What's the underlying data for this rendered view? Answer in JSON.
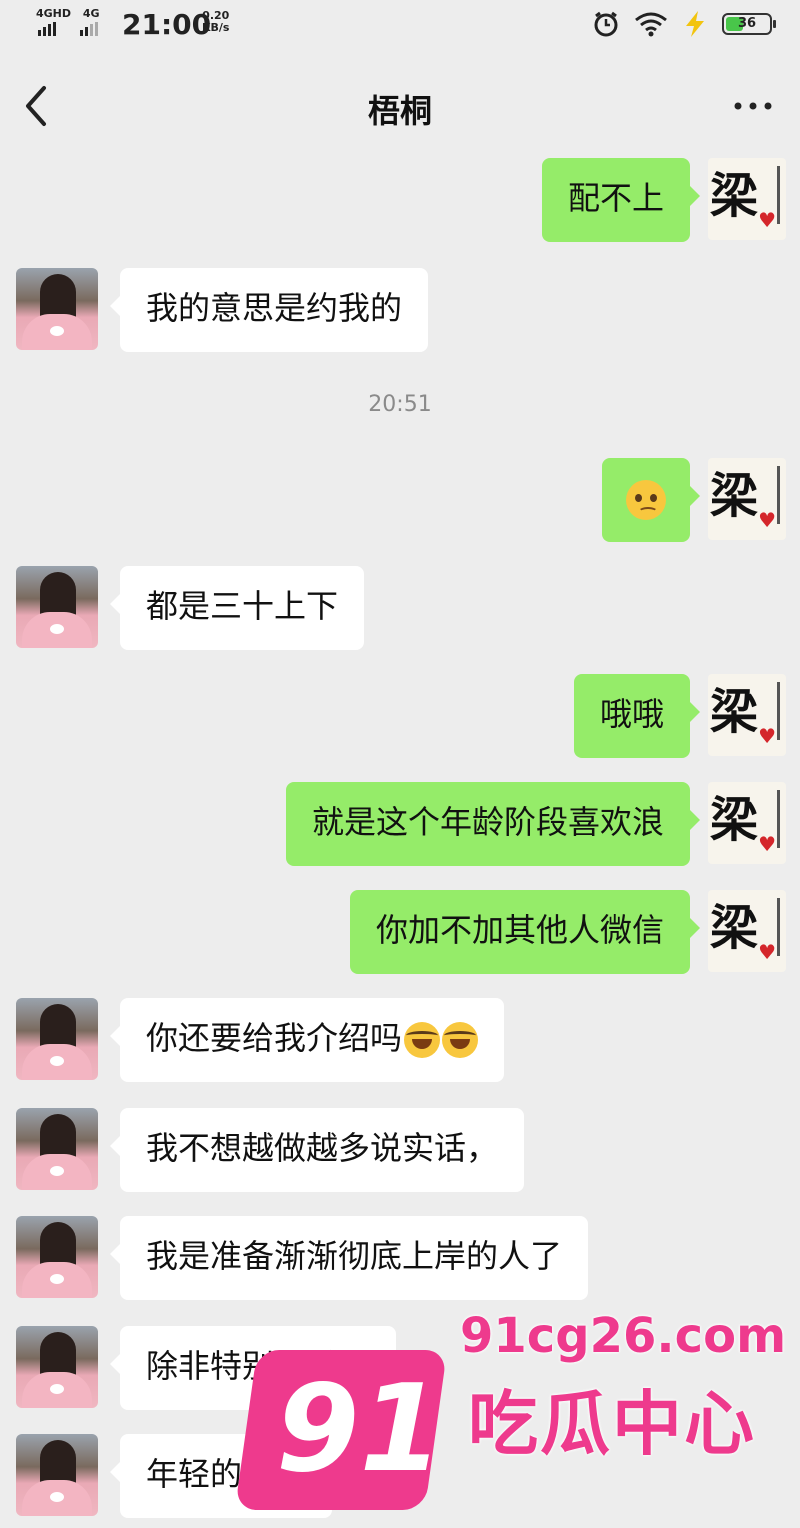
{
  "status_bar": {
    "network_1": "4GHD",
    "network_2": "4G",
    "time": "21:00",
    "speed_value": "0.20",
    "speed_unit": "KB/s",
    "battery_level": "36",
    "battery_color": "#49c64a"
  },
  "header": {
    "title": "梧桐"
  },
  "chat": {
    "timestamp": "20:51",
    "messages": [
      {
        "side": "out",
        "text": "配不上"
      },
      {
        "side": "in",
        "text": "我的意思是约我的"
      },
      {
        "side": "out",
        "text": "",
        "emoji": "woozy-face-emoji"
      },
      {
        "side": "in",
        "text": "都是三十上下"
      },
      {
        "side": "out",
        "text": "哦哦"
      },
      {
        "side": "out",
        "text": "就是这个年龄阶段喜欢浪"
      },
      {
        "side": "out",
        "text": "你加不加其他人微信"
      },
      {
        "side": "in",
        "text": "你还要给我介绍吗",
        "emoji": "laughing-crying-emoji"
      },
      {
        "side": "in",
        "text": "我不想越做越多说实话，"
      },
      {
        "side": "in",
        "text": "我是准备渐渐彻底上岸的人了"
      },
      {
        "side": "in",
        "text": "除非特别靠谱的"
      },
      {
        "side": "in",
        "text": "年轻的可以"
      }
    ],
    "right_avatar_glyph": "梁",
    "bubble_out_color": "#95ec69",
    "bubble_in_color": "#ffffff"
  },
  "watermark": {
    "badge_number": "91",
    "url": "91cg26.com",
    "brand": "吃瓜中心",
    "color": "#ee3a8d"
  }
}
